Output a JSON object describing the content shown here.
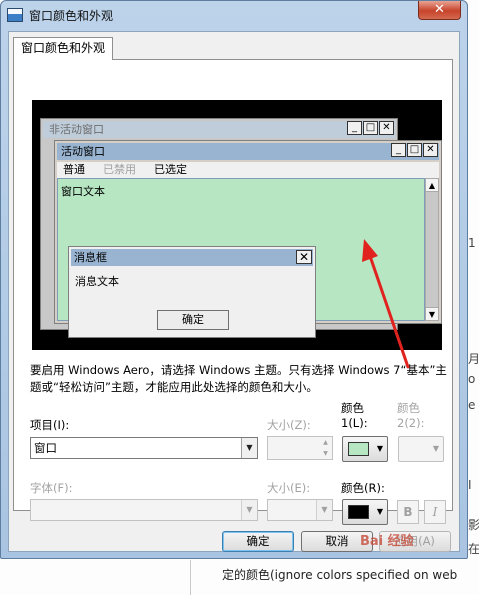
{
  "window": {
    "title": "窗口颜色和外观",
    "close_label": "✕"
  },
  "tab": {
    "label": "窗口颜色和外观"
  },
  "preview": {
    "inactive_title": "非活动窗口",
    "active_title": "活动窗口",
    "menu_items": [
      "普通",
      "已禁用",
      "已选定"
    ],
    "window_text": "窗口文本",
    "messagebox_title": "消息框",
    "message_text": "消息文本",
    "ok_label": "确定"
  },
  "description": "要启用 Windows Aero，请选择 Windows 主题。只有选择 Windows 7“基本”主题或“轻松访问”主题，才能应用此处选择的颜色和大小。",
  "form": {
    "item_label": "项目(I):",
    "item_value": "窗口",
    "size1_label": "大小(Z):",
    "color1_label_line1": "颜色",
    "color1_label_line2": "1(L):",
    "color2_label_line1": "颜色",
    "color2_label_line2": "2(2):",
    "font_label": "字体(F):",
    "size2_label": "大小(E):",
    "fontcolor_label": "颜色(R):",
    "bold_label": "B",
    "italic_label": "I",
    "color1": "#b7e6c3",
    "fontcolor": "#000000"
  },
  "buttons": {
    "ok": "确定",
    "cancel": "取消",
    "apply": "应用(A)"
  },
  "background": {
    "text": "定的颜色(ignore colors specified on web",
    "watermark": "Bai 经验"
  }
}
